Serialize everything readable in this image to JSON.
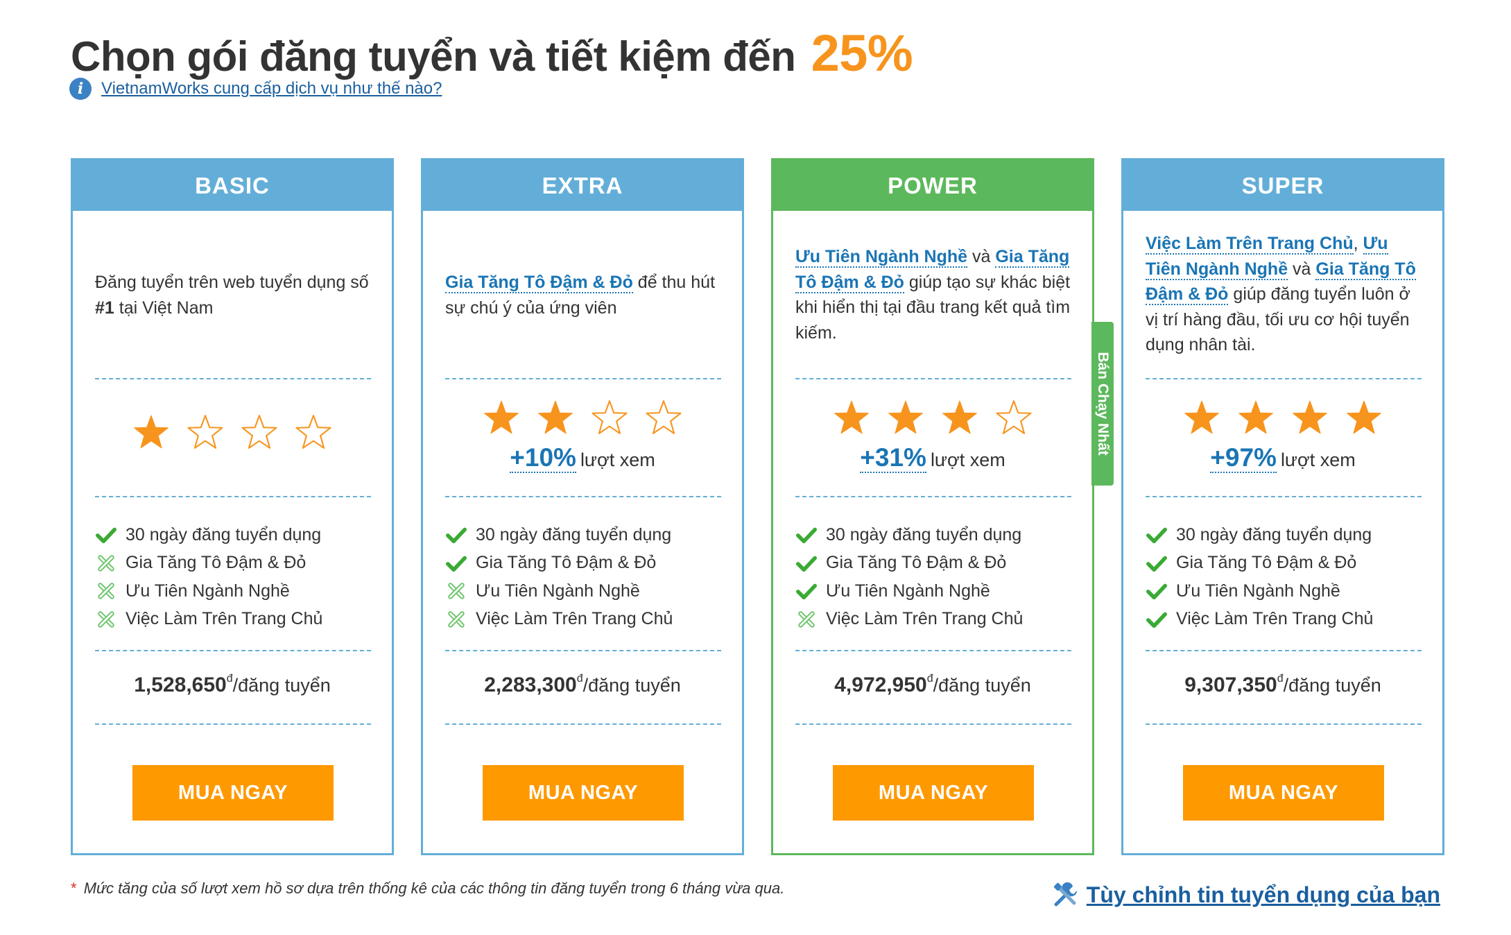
{
  "header": {
    "title": "Chọn gói đăng tuyển và tiết kiệm đến",
    "percent": "25%",
    "info_link": "VietnamWorks cung cấp dịch vụ như thế nào?"
  },
  "colors": {
    "blue": "#63aed8",
    "green": "#5cb85c",
    "orange": "#ff9900",
    "link": "#1a75b5"
  },
  "plans": [
    {
      "name": "BASIC",
      "desc": {
        "t1": "Đăng tuyển trên web tuyển dụng số ",
        "bold": "#1",
        "t2": " tại Việt Nam"
      },
      "stars_filled": 1,
      "stars_total": 4,
      "features": [
        {
          "label": "30 ngày đăng tuyển dụng",
          "included": true
        },
        {
          "label": "Gia Tăng Tô Đậm & Đỏ",
          "included": false
        },
        {
          "label": "Ưu Tiên Ngành Nghề",
          "included": false
        },
        {
          "label": "Việc Làm Trên Trang Chủ",
          "included": false
        }
      ],
      "price": "1,528,650",
      "currency": "đ",
      "unit": "/đăng tuyển",
      "button": "MUA NGAY"
    },
    {
      "name": "EXTRA",
      "desc": {
        "link1": "Gia Tăng Tô Đậm & Đỏ",
        "t1": " để thu hút sự chú ý của ứng viên"
      },
      "stars_filled": 2,
      "stars_total": 4,
      "views_pct": "+10%",
      "views_label": "lượt xem",
      "features": [
        {
          "label": "30 ngày đăng tuyển dụng",
          "included": true
        },
        {
          "label": "Gia Tăng Tô Đậm & Đỏ",
          "included": true
        },
        {
          "label": "Ưu Tiên Ngành Nghề",
          "included": false
        },
        {
          "label": "Việc Làm Trên Trang Chủ",
          "included": false
        }
      ],
      "price": "2,283,300",
      "currency": "đ",
      "unit": "/đăng tuyển",
      "button": "MUA NGAY"
    },
    {
      "name": "POWER",
      "desc": {
        "link1": "Ưu Tiên Ngành Nghề",
        "t1": " và ",
        "link2": "Gia Tăng Tô Đậm & Đỏ",
        "t2": " giúp tạo sự khác biệt khi hiển thị tại đầu trang kết quả tìm kiếm."
      },
      "stars_filled": 3,
      "stars_total": 4,
      "views_pct": "+31%",
      "views_label": "lượt xem",
      "features": [
        {
          "label": "30 ngày đăng tuyển dụng",
          "included": true
        },
        {
          "label": "Gia Tăng Tô Đậm & Đỏ",
          "included": true
        },
        {
          "label": "Ưu Tiên Ngành Nghề",
          "included": true
        },
        {
          "label": "Việc Làm Trên Trang Chủ",
          "included": false
        }
      ],
      "price": "4,972,950",
      "currency": "đ",
      "unit": "/đăng tuyển",
      "button": "MUA NGAY",
      "ribbon": "Bán Chạy Nhất"
    },
    {
      "name": "SUPER",
      "desc": {
        "link1": "Việc Làm Trên Trang Chủ",
        "t1": ", ",
        "link2": "Ưu Tiên Ngành Nghề",
        "t2": " và ",
        "link3": "Gia Tăng Tô Đậm & Đỏ",
        "t3": " giúp đăng tuyển luôn ở vị trí hàng đầu, tối ưu cơ hội tuyển dụng nhân tài."
      },
      "stars_filled": 4,
      "stars_total": 4,
      "views_pct": "+97%",
      "views_label": "lượt xem",
      "features": [
        {
          "label": "30 ngày đăng tuyển dụng",
          "included": true
        },
        {
          "label": "Gia Tăng Tô Đậm & Đỏ",
          "included": true
        },
        {
          "label": "Ưu Tiên Ngành Nghề",
          "included": true
        },
        {
          "label": "Việc Làm Trên Trang Chủ",
          "included": true
        }
      ],
      "price": "9,307,350",
      "currency": "đ",
      "unit": "/đăng tuyển",
      "button": "MUA NGAY"
    }
  ],
  "footer": {
    "asterisk": "*",
    "note": "Mức tăng của số lượt xem hồ sơ dựa trên thống kê của các thông tin đăng tuyển trong 6 tháng vừa qua.",
    "custom_link": "Tùy chỉnh tin tuyển dụng của bạn"
  },
  "icons": {
    "info": "info-icon",
    "check": "check-icon",
    "cross": "cross-icon",
    "star_filled": "star-filled-icon",
    "star_empty": "star-empty-icon",
    "tools": "tools-icon"
  }
}
